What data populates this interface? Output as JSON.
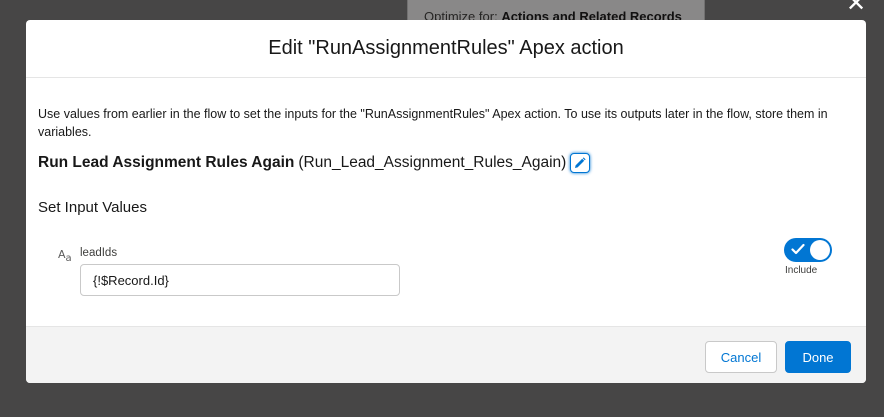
{
  "background": {
    "optimize_label": "Optimize for:",
    "optimize_value": "Actions and Related Records"
  },
  "modal": {
    "title": "Edit \"RunAssignmentRules\" Apex action",
    "description": "Use values from earlier in the flow to set the inputs for the \"RunAssignmentRules\" Apex action. To use its outputs later in the flow, store them in variables.",
    "action_label": "Run Lead Assignment Rules Again",
    "action_api_name": "(Run_Lead_Assignment_Rules_Again)",
    "section_title": "Set Input Values",
    "input": {
      "type_icon": "text-type-icon",
      "label": "leadIds",
      "value": "{!$Record.Id}",
      "include_label": "Include",
      "include_on": true
    },
    "footer": {
      "cancel_label": "Cancel",
      "done_label": "Done"
    }
  },
  "colors": {
    "brand": "#0176d3",
    "footer_bg": "#f3f3f3"
  }
}
